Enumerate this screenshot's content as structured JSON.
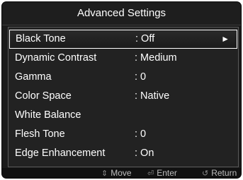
{
  "title": "Advanced Settings",
  "items": [
    {
      "label": "Black Tone",
      "value": ": Off",
      "arrow": "►"
    },
    {
      "label": "Dynamic Contrast",
      "value": ": Medium"
    },
    {
      "label": "Gamma",
      "value": ": 0"
    },
    {
      "label": "Color Space",
      "value": ": Native"
    },
    {
      "label": "White Balance",
      "value": ""
    },
    {
      "label": "Flesh Tone",
      "value": ": 0"
    },
    {
      "label": "Edge Enhancement",
      "value": ": On"
    }
  ],
  "footer": {
    "move": {
      "icon": "up-down-icon",
      "glyph": "⇕",
      "label": "Move"
    },
    "enter": {
      "icon": "enter-icon",
      "glyph": "⏎",
      "label": "Enter"
    },
    "return": {
      "icon": "return-icon",
      "glyph": "↺",
      "label": "Return"
    }
  }
}
